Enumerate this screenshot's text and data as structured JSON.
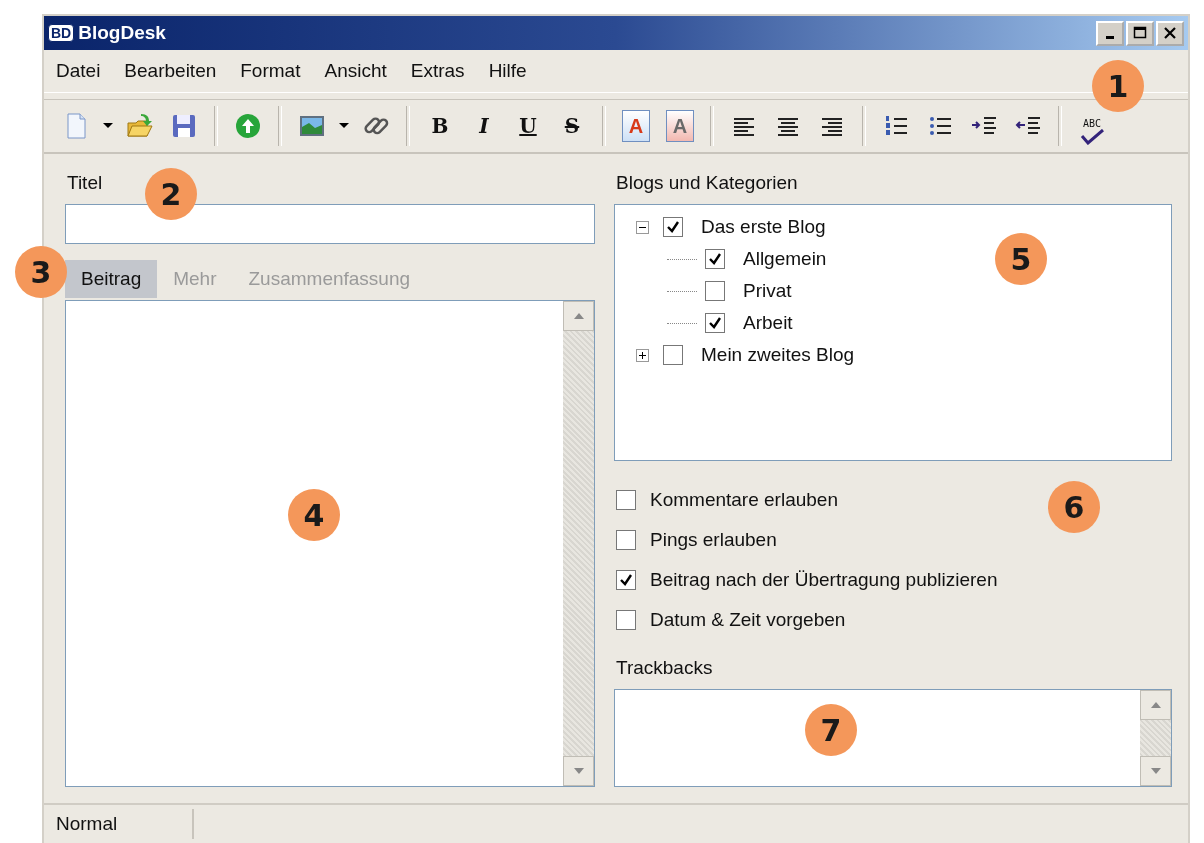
{
  "window": {
    "title": "BlogDesk",
    "logo": "BD"
  },
  "menu": [
    "Datei",
    "Bearbeiten",
    "Format",
    "Ansicht",
    "Extras",
    "Hilfe"
  ],
  "toolbar": {
    "callout": "1",
    "items": [
      {
        "kind": "new"
      },
      {
        "kind": "dropdown"
      },
      {
        "kind": "open"
      },
      {
        "kind": "save"
      },
      {
        "kind": "sep"
      },
      {
        "kind": "publish"
      },
      {
        "kind": "sep"
      },
      {
        "kind": "image"
      },
      {
        "kind": "dropdown"
      },
      {
        "kind": "link"
      },
      {
        "kind": "sep"
      },
      {
        "kind": "bold",
        "label": "B"
      },
      {
        "kind": "italic",
        "label": "I"
      },
      {
        "kind": "underline",
        "label": "U"
      },
      {
        "kind": "strike",
        "label": "S"
      },
      {
        "kind": "sep"
      },
      {
        "kind": "textcolor",
        "label": "A"
      },
      {
        "kind": "highlight",
        "label": "A"
      },
      {
        "kind": "sep"
      },
      {
        "kind": "align-left"
      },
      {
        "kind": "align-center"
      },
      {
        "kind": "align-right"
      },
      {
        "kind": "sep"
      },
      {
        "kind": "numbered"
      },
      {
        "kind": "bullets"
      },
      {
        "kind": "indent"
      },
      {
        "kind": "outdent"
      },
      {
        "kind": "sep"
      },
      {
        "kind": "spell",
        "label": "ABC"
      }
    ]
  },
  "title_field": {
    "label": "Titel",
    "callout": "2"
  },
  "tabs": {
    "callout": "3",
    "items": [
      {
        "label": "Beitrag",
        "selected": true
      },
      {
        "label": "Mehr",
        "selected": false
      },
      {
        "label": "Zusammenfassung",
        "selected": false
      }
    ]
  },
  "editor": {
    "callout": "4"
  },
  "blogs": {
    "label": "Blogs und Kategorien",
    "callout": "5",
    "tree": [
      {
        "label": "Das erste Blog",
        "checked": true,
        "expanded": true,
        "children": [
          {
            "label": "Allgemein",
            "checked": true
          },
          {
            "label": "Privat",
            "checked": false
          },
          {
            "label": "Arbeit",
            "checked": true
          }
        ]
      },
      {
        "label": "Mein zweites Blog",
        "checked": false,
        "expanded": false
      }
    ]
  },
  "options": {
    "callout": "6",
    "items": [
      {
        "label": "Kommentare erlauben",
        "checked": false
      },
      {
        "label": "Pings erlauben",
        "checked": false
      },
      {
        "label": "Beitrag nach der Übertragung publizieren",
        "checked": true
      },
      {
        "label": "Datum & Zeit vorgeben",
        "checked": false
      }
    ]
  },
  "trackbacks": {
    "label": "Trackbacks",
    "callout": "7"
  },
  "status_bar": {
    "mode": "Normal"
  }
}
